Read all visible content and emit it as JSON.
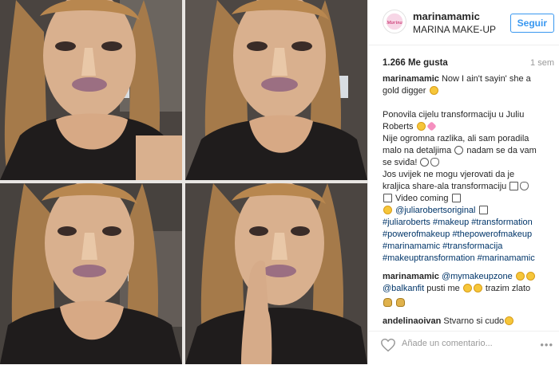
{
  "post": {
    "image_alt": "Four portrait photos of a woman with contour makeup",
    "panels": [
      {
        "label": "portrait-1"
      },
      {
        "label": "portrait-2"
      },
      {
        "label": "portrait-3"
      },
      {
        "label": "portrait-4"
      }
    ]
  },
  "header": {
    "username": "marinamamic",
    "full_name": "MARINA MAKE-UP",
    "avatar_text": "Marina",
    "follow_label": "Seguir"
  },
  "stats": {
    "likes": "1.266 Me gusta",
    "age": "1 sem"
  },
  "caption": {
    "user": "marinamamic",
    "line1": "Now I ain't sayin' she a",
    "line2": "gold digger",
    "l3": "Ponovila cijelu transformaciju u Juliu",
    "l4": "Roberts",
    "l5": "Nije ogromna razlika, ali sam poradila",
    "l6a": "malo na detaljima",
    "l6b": " nadam se da vam",
    "l7": "se sviđa!",
    "l8": "Jos uvijek ne mogu vjerovati da je",
    "l9": "kraljica share-ala transformaciju",
    "l10": " Video coming",
    "l11": "@juliarobertsoriginal",
    "l12": "#juliaroberts #makeup #transformation",
    "l13": "#powerofmakeup #thepowerofmakeup",
    "l14": "#marinamamic #transformacija",
    "l15": "#makeuptransformation #marinamamic"
  },
  "comments": [
    {
      "user": "marinamamic",
      "text1": "@mymakeupzone",
      "text2a": "@balkanfit",
      "text2b": " pusti me",
      "text2c": " trazim zlato"
    },
    {
      "user": "andelinaoivan",
      "text": "Stvarno si cudo"
    }
  ],
  "footer": {
    "placeholder": "Añade un comentario...",
    "more": "•••"
  },
  "colors": {
    "link": "#003569",
    "follow_blue": "#3897f0",
    "border": "#efefef",
    "muted": "#999999"
  },
  "icons": [
    "heart-icon",
    "more-icon",
    "laughing-emoji-icon",
    "heart-emoji-icon",
    "wink-emoji-icon",
    "video-emoji-icon",
    "money-bag-emoji-icon"
  ]
}
